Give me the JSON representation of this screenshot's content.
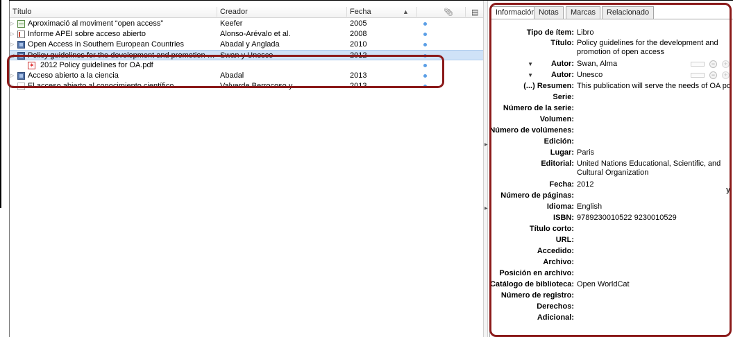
{
  "columns": {
    "title": "Título",
    "creator": "Creador",
    "date": "Fecha",
    "sort_indicator": "▲",
    "attachment_icon": "paperclip-icon",
    "column_picker_icon": "column-picker-icon"
  },
  "items": [
    {
      "title": "Aproximació al moviment “open access”",
      "creator": "Keefer",
      "date": "2005",
      "icon": "table-icon",
      "has_attachment": true
    },
    {
      "title": "Informe APEI sobre acceso abierto",
      "creator": "Alonso-Arévalo et al.",
      "date": "2008",
      "icon": "report-icon",
      "has_attachment": true
    },
    {
      "title": "Open Access in Southern European Countries",
      "creator": "Abadal y Anglada",
      "date": "2010",
      "icon": "book-icon",
      "has_attachment": true
    },
    {
      "title": "Policy guidelines for the development and promotion of o...",
      "creator": "Swan y Unesco",
      "date": "2012",
      "icon": "book-icon",
      "has_attachment": true,
      "selected": true
    },
    {
      "title": "2012 Policy guidelines for OA.pdf",
      "creator": "",
      "date": "",
      "icon": "pdf-icon",
      "has_attachment": true,
      "child": true
    },
    {
      "title": "Acceso abierto a la ciencia",
      "creator": "Abadal",
      "date": "2013",
      "icon": "book-icon",
      "has_attachment": true
    },
    {
      "title": "El acceso abierto al conocimiento científico",
      "creator": "Valverde Berrocoso y",
      "date": "2013",
      "icon": "page-icon",
      "has_attachment": true
    }
  ],
  "tabs": [
    "Información",
    "Notas",
    "Marcas",
    "Relacionado"
  ],
  "fields": {
    "item_type": {
      "label": "Tipo de ítem:",
      "value": "Libro"
    },
    "title": {
      "label": "Título:",
      "value": "Policy guidelines for the development and promotion of open access"
    },
    "author1": {
      "label": "Autor:",
      "value": "Swan, Alma"
    },
    "author2": {
      "label": "Autor:",
      "value": "Unesco"
    },
    "abstract": {
      "label": "(...) Resumen:",
      "value": "This publication will serve the needs of OA pol..."
    },
    "series": {
      "label": "Serie:",
      "value": ""
    },
    "series_number": {
      "label": "Número de la serie:",
      "value": ""
    },
    "volume": {
      "label": "Volumen:",
      "value": ""
    },
    "num_volumes": {
      "label": "Número de volúmenes:",
      "value": ""
    },
    "edition": {
      "label": "Edición:",
      "value": ""
    },
    "place": {
      "label": "Lugar:",
      "value": "Paris"
    },
    "publisher": {
      "label": "Editorial:",
      "value": "United Nations Educational, Scientific, and Cultural Organization"
    },
    "date": {
      "label": "Fecha:",
      "value": "2012",
      "extra": "y"
    },
    "pages": {
      "label": "Número de páginas:",
      "value": ""
    },
    "language": {
      "label": "Idioma:",
      "value": "English"
    },
    "isbn": {
      "label": "ISBN:",
      "value": "9789230010522 9230010529"
    },
    "short_title": {
      "label": "Título corto:",
      "value": ""
    },
    "url": {
      "label": "URL:",
      "value": ""
    },
    "accessed": {
      "label": "Accedido:",
      "value": ""
    },
    "archive": {
      "label": "Archivo:",
      "value": ""
    },
    "archive_location": {
      "label": "Posición en archivo:",
      "value": ""
    },
    "library_catalog": {
      "label": "Catálogo de biblioteca:",
      "value": "Open WorldCat"
    },
    "call_number": {
      "label": "Número de registro:",
      "value": ""
    },
    "rights": {
      "label": "Derechos:",
      "value": ""
    },
    "extra": {
      "label": "Adicional:",
      "value": ""
    }
  },
  "colors": {
    "selection": "#cfe2f7",
    "highlight": "#8b1a1a",
    "attachment_dot": "#5b9fe6"
  }
}
